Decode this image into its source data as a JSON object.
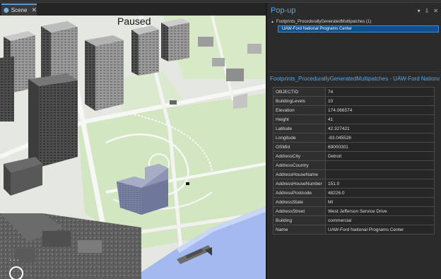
{
  "scene": {
    "tab_label": "Scene",
    "close_glyph": "✕",
    "status_overlay": "Paused",
    "nav_dots": "• • •"
  },
  "popup": {
    "title": "Pop-up",
    "controls": [
      "▾",
      "⇩",
      "✕"
    ],
    "tree": {
      "caret": "▲",
      "layer_label": "Footprints_ProcedurallyGeneratedMultipatches (1)",
      "selected_feature": "UAW-Ford National Programs Center"
    },
    "feature_title": "Footprints_ProcedurallyGeneratedMultipatches - UAW-Ford National...",
    "attributes": [
      {
        "field": "OBJECTID",
        "value": "74"
      },
      {
        "field": "BuildingLevels",
        "value": "10"
      },
      {
        "field": "Elevation",
        "value": "174.066574"
      },
      {
        "field": "Height",
        "value": "41"
      },
      {
        "field": "Latitude",
        "value": "42.327421"
      },
      {
        "field": "Longitude",
        "value": "-83.045528"
      },
      {
        "field": "OSMId",
        "value": "69000301"
      },
      {
        "field": "AddressCity",
        "value": "Detroit"
      },
      {
        "field": "AddressCountry",
        "value": ""
      },
      {
        "field": "AddressHouseName",
        "value": ""
      },
      {
        "field": "AddressHouseNumber",
        "value": "151.0"
      },
      {
        "field": "AddressPostcode",
        "value": "48226.0"
      },
      {
        "field": "AddressState",
        "value": "MI"
      },
      {
        "field": "AddressStreet",
        "value": "West Jefferson Service Drive"
      },
      {
        "field": "Building",
        "value": "commercial"
      },
      {
        "field": "Name",
        "value": "UAW-Ford National Programs Center"
      }
    ]
  },
  "colors": {
    "accent_blue": "#5aa7e6",
    "selection_fill": "#0f4f8a",
    "panel_bg": "#2b2b2b",
    "water": "#9fb7f2",
    "park": "#d6e8c4"
  },
  "icons": [
    "globe-icon",
    "close-icon",
    "dropdown-icon",
    "pin-icon",
    "navigation-control-icon"
  ]
}
